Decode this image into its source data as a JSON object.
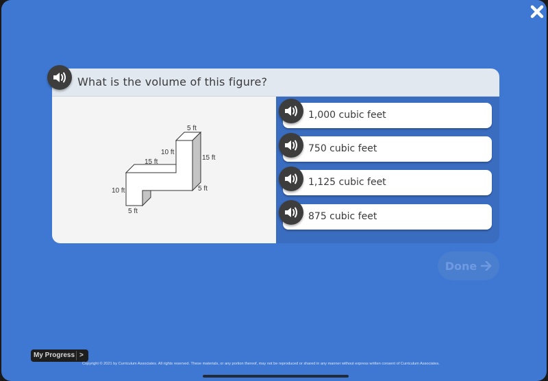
{
  "question": {
    "text": "What is the volume of this figure?",
    "audio_icon": "speaker-icon"
  },
  "figure": {
    "labels": {
      "top_width": "5 ft",
      "upper_height": "10 ft",
      "right_height": "15 ft",
      "middle_length": "15 ft",
      "left_height": "10 ft",
      "right_depth": "5 ft",
      "bottom_width": "5 ft"
    }
  },
  "answers": [
    {
      "label": "1,000 cubic feet"
    },
    {
      "label": "750 cubic feet"
    },
    {
      "label": "1,125 cubic feet"
    },
    {
      "label": "875 cubic feet"
    }
  ],
  "done_button": {
    "label": "Done",
    "icon": "arrow-right-icon",
    "enabled": false
  },
  "close_button": {
    "icon": "close-icon"
  },
  "my_progress": {
    "label": "My Progress",
    "arrow": ">"
  },
  "footer": {
    "copyright": "Copyright © 2021 by Curriculum Associates. All rights reserved. These materials, or any portion thereof, may not be reproduced or shared in any manner without express written consent of Curriculum Associates."
  },
  "colors": {
    "background": "#3f78d2",
    "header": "#e2e8f0",
    "answers_panel": "#3a6cbf",
    "speaker": "#3d3d3d"
  }
}
